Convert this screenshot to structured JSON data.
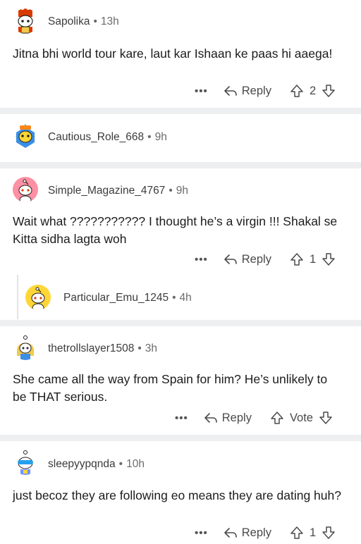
{
  "comments": [
    {
      "username": "Sapolika",
      "time": "13h",
      "avatar_icon": "snoo-avatar-red-hat-icon",
      "text": "Jitna bhi world tour kare, laut kar Ishaan ke paas hi aaega!",
      "reply_label": "Reply",
      "votes": "2"
    },
    {
      "username": "Cautious_Role_668",
      "time": "9h",
      "avatar_icon": "snoo-avatar-teal-hat-icon"
    },
    {
      "username": "Simple_Magazine_4767",
      "time": "9h",
      "avatar_icon": "snoo-avatar-pink-default-icon",
      "text": "Wait what ??????????? I thought he’s a virgin !!! Shakal se Kitta sidha lagta woh",
      "reply_label": "Reply",
      "votes": "1"
    },
    {
      "username": "Particular_Emu_1245",
      "time": "4h",
      "avatar_icon": "snoo-avatar-yellow-default-icon"
    },
    {
      "username": "thetrollslayer1508",
      "time": "3h",
      "avatar_icon": "snoo-avatar-blonde-icon",
      "text": "She came all the way from Spain for him? He’s unlikely to be THAT serious.",
      "reply_label": "Reply",
      "votes": "Vote"
    },
    {
      "username": "sleepyypqnda",
      "time": "10h",
      "avatar_icon": "snoo-avatar-goggles-icon",
      "text": "just becoz they are following eo means they are dating huh?",
      "reply_label": "Reply",
      "votes": "1"
    }
  ],
  "more_label": "•••",
  "colors": {
    "separator": "#edeff1",
    "text": "#1c1c1c",
    "meta": "#6b6b6b"
  }
}
